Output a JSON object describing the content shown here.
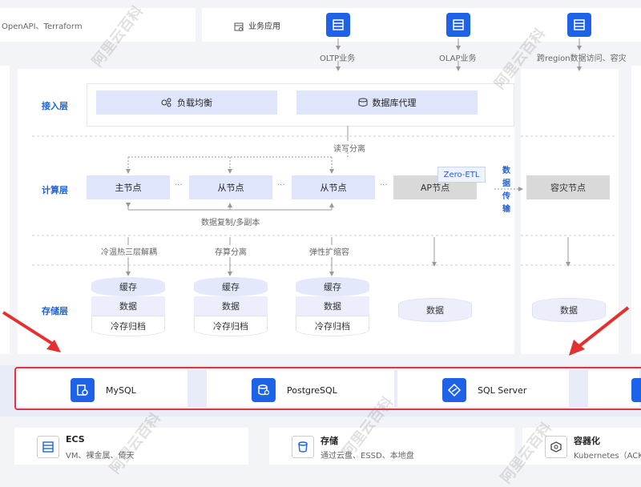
{
  "top": {
    "left_text": "OpenAPI、Terraform",
    "biz_label": "业务应用",
    "apps": [
      {
        "label": "OLTP业务"
      },
      {
        "label": "OLAP业务"
      },
      {
        "label": "跨region数据访问、容灾"
      }
    ]
  },
  "access_layer": {
    "label": "接入层",
    "load_balance": "负载均衡",
    "db_proxy": "数据库代理"
  },
  "rw_split": "读写分离",
  "compute_layer": {
    "label": "计算层",
    "primary": "主节点",
    "replica1": "从节点",
    "replica2": "从节点",
    "ap_node": "AP节点",
    "zero_etl": "Zero-ETL",
    "ellipsis": "···",
    "data_transfer": [
      "数",
      "据",
      "传",
      "输"
    ],
    "dr_node": "容灾节点"
  },
  "replication": "数据复制/多副本",
  "features": [
    "冷温热三层解耦",
    "存算分离",
    "弹性扩缩容"
  ],
  "storage_layer": {
    "label": "存储层",
    "cache": "缓存",
    "data": "数据",
    "cold": "冷存归档"
  },
  "databases": [
    {
      "name": "MySQL"
    },
    {
      "name": "PostgreSQL"
    },
    {
      "name": "SQL Server"
    }
  ],
  "infra": [
    {
      "title": "ECS",
      "sub": "VM、裸金属、倚天"
    },
    {
      "title": "存储",
      "sub": "通过云盘、ESSD、本地盘"
    },
    {
      "title": "容器化",
      "sub": "Kubernetes（ACK"
    }
  ],
  "watermark": "阿里云百科",
  "colors": {
    "accent": "#1e62e8",
    "arrow_red": "#e53030"
  }
}
